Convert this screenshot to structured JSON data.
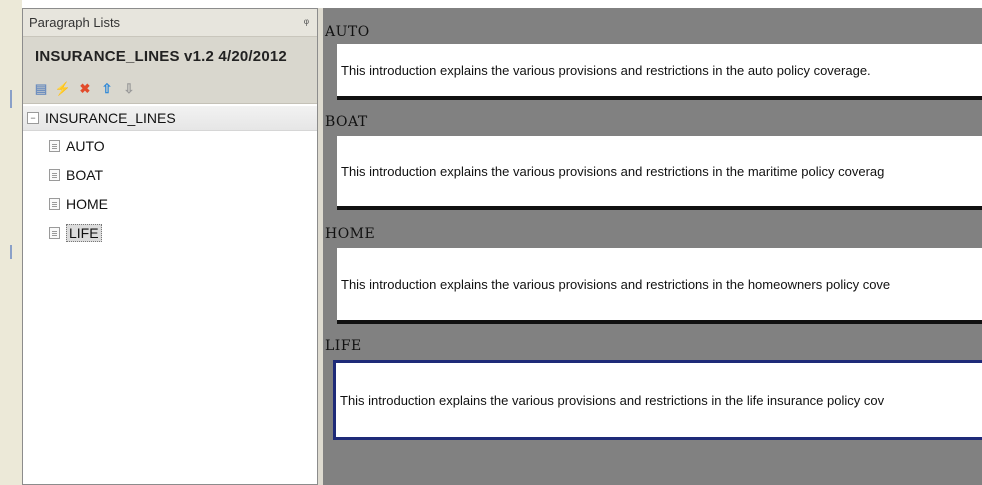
{
  "panel": {
    "title": "Paragraph Lists",
    "pin_glyph": "ᵠ",
    "document_title": "INSURANCE_LINES v1.2 4/20/2012",
    "toolbar": [
      {
        "name": "new-icon",
        "glyph": "▤",
        "color": "#6f8fbf"
      },
      {
        "name": "lightning-icon",
        "glyph": "⚡",
        "color": "#2fb52f"
      },
      {
        "name": "delete-icon",
        "glyph": "✖",
        "color": "#e24b2b"
      },
      {
        "name": "up-arrow-icon",
        "glyph": "⇧",
        "color": "#2a86d8"
      },
      {
        "name": "down-arrow-icon",
        "glyph": "⇩",
        "color": "#9a9a9a"
      }
    ],
    "tree": {
      "root_toggle": "−",
      "root_label": "INSURANCE_LINES",
      "items": [
        {
          "label": "AUTO",
          "selected": false
        },
        {
          "label": "BOAT",
          "selected": false
        },
        {
          "label": "HOME",
          "selected": false
        },
        {
          "label": "LIFE",
          "selected": true
        }
      ]
    }
  },
  "preview": {
    "sections": [
      {
        "label": "AUTO",
        "text": "This introduction explains the various provisions and restrictions in the auto policy coverage."
      },
      {
        "label": "BOAT",
        "text": "This introduction explains the various provisions and restrictions in the maritime policy coverag"
      },
      {
        "label": "HOME",
        "text": "This introduction explains the various provisions and restrictions in the homeowners policy cove"
      },
      {
        "label": "LIFE",
        "text": "This introduction explains the various provisions and restrictions in the life insurance policy cov"
      }
    ]
  },
  "colors": {
    "preview_background": "#818181",
    "selection_border": "#1e2a78",
    "panel_header": "#e7e5dd"
  }
}
